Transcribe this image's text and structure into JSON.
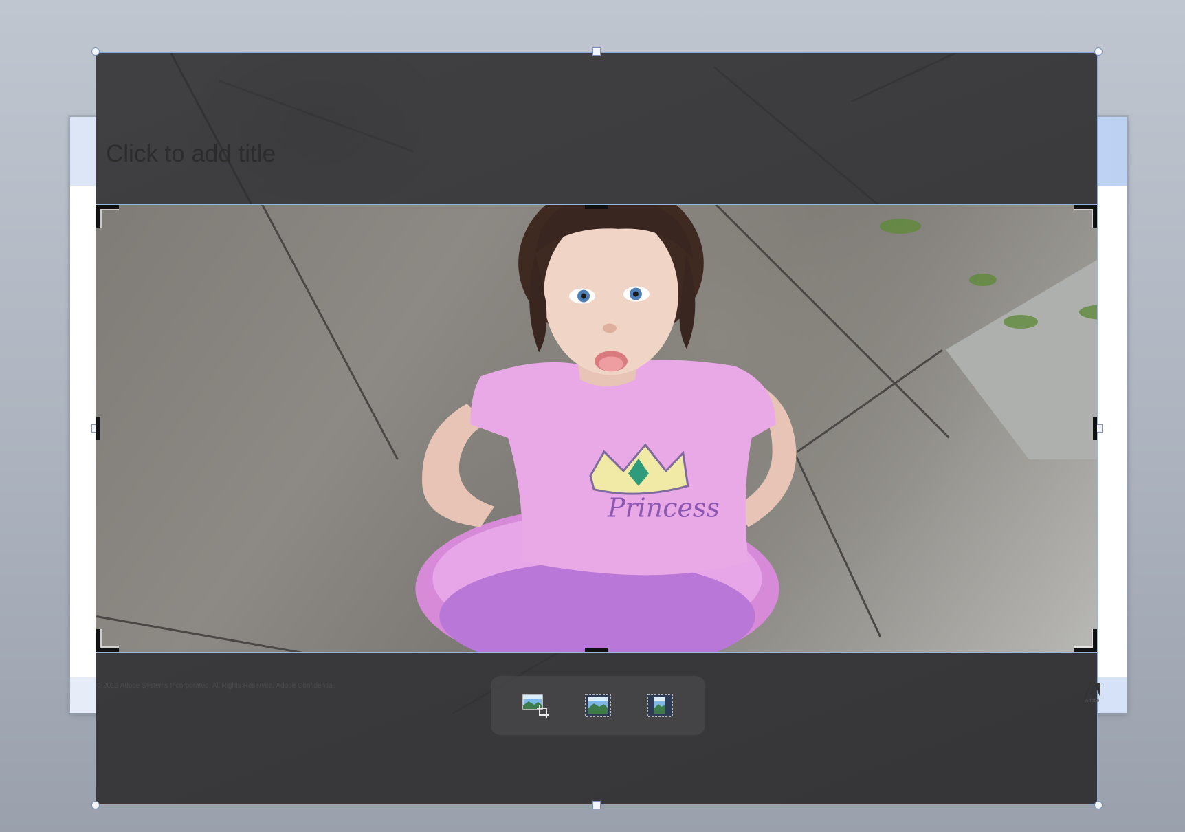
{
  "slide": {
    "title_placeholder": "Click to add title",
    "footer": "© 2013 Adobe Systems Incorporated.  All Rights Reserved.  Adobe Confidential.",
    "logo_text": "Adobe"
  },
  "shirt_text": "Princess",
  "toolbar": {
    "buttons": [
      {
        "icon": "crop-picture-icon"
      },
      {
        "icon": "fill-icon"
      },
      {
        "icon": "fit-icon"
      }
    ]
  },
  "colors": {
    "selection_handle": "#7b94c2",
    "toolbar_bg": "#464648",
    "title_band": "#c9d9f4"
  }
}
